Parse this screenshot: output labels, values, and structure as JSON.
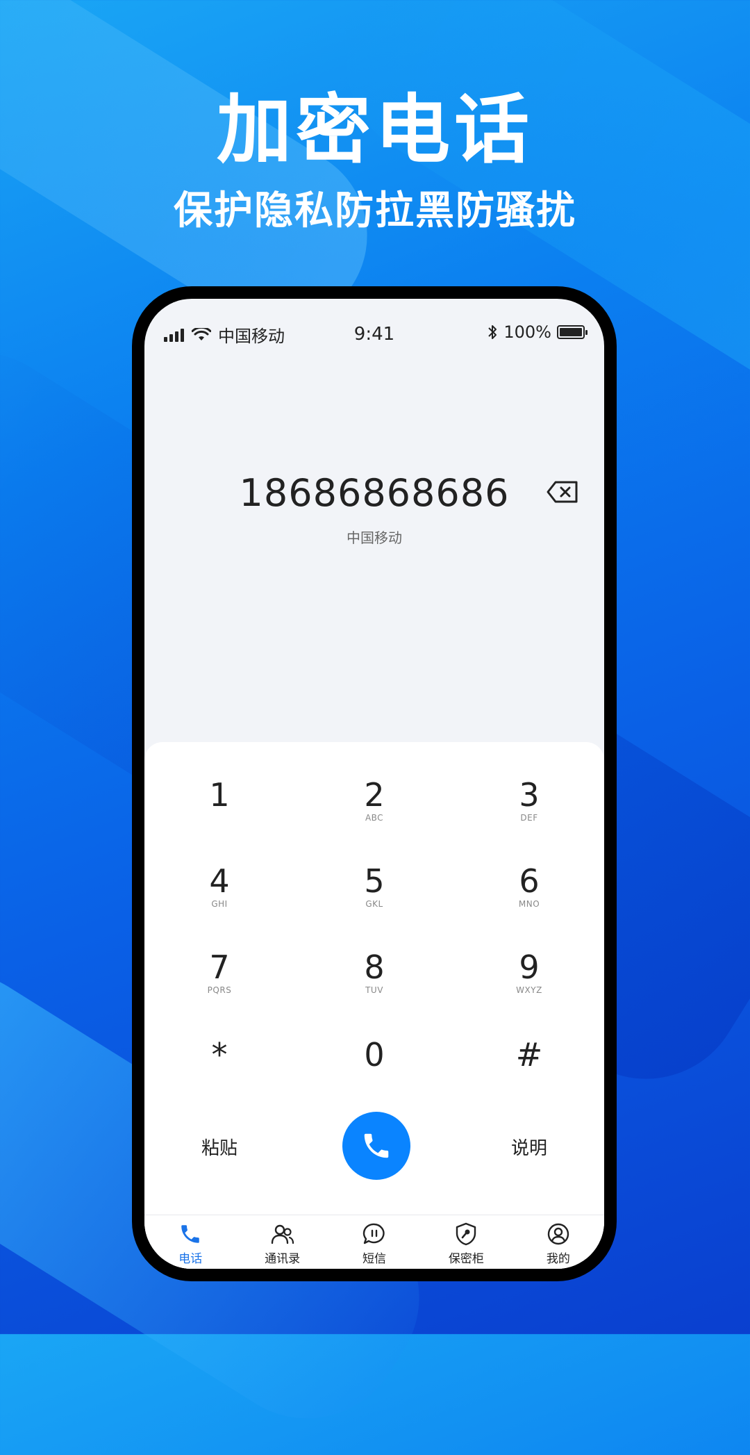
{
  "promo": {
    "title": "加密电话",
    "subtitle": "保护隐私防拉黑防骚扰"
  },
  "status_bar": {
    "carrier": "中国移动",
    "time": "9:41",
    "battery": "100%"
  },
  "dialer": {
    "number": "18686868686",
    "carrier_label": "中国移动"
  },
  "keypad": {
    "keys": [
      {
        "digit": "1",
        "letters": ""
      },
      {
        "digit": "2",
        "letters": "ABC"
      },
      {
        "digit": "3",
        "letters": "DEF"
      },
      {
        "digit": "4",
        "letters": "GHI"
      },
      {
        "digit": "5",
        "letters": "GKL"
      },
      {
        "digit": "6",
        "letters": "MNO"
      },
      {
        "digit": "7",
        "letters": "PQRS"
      },
      {
        "digit": "8",
        "letters": "TUV"
      },
      {
        "digit": "9",
        "letters": "WXYZ"
      },
      {
        "digit": "*",
        "letters": ""
      },
      {
        "digit": "0",
        "letters": ""
      },
      {
        "digit": "#",
        "letters": ""
      }
    ],
    "paste_label": "粘贴",
    "help_label": "说明"
  },
  "tabbar": {
    "items": [
      {
        "label": "电话",
        "icon": "phone-icon",
        "active": true
      },
      {
        "label": "通讯录",
        "icon": "contacts-icon",
        "active": false
      },
      {
        "label": "短信",
        "icon": "message-icon",
        "active": false
      },
      {
        "label": "保密柜",
        "icon": "shield-key-icon",
        "active": false
      },
      {
        "label": "我的",
        "icon": "profile-icon",
        "active": false
      }
    ]
  },
  "colors": {
    "accent": "#0a84ff",
    "tab_active": "#1a73e8"
  }
}
